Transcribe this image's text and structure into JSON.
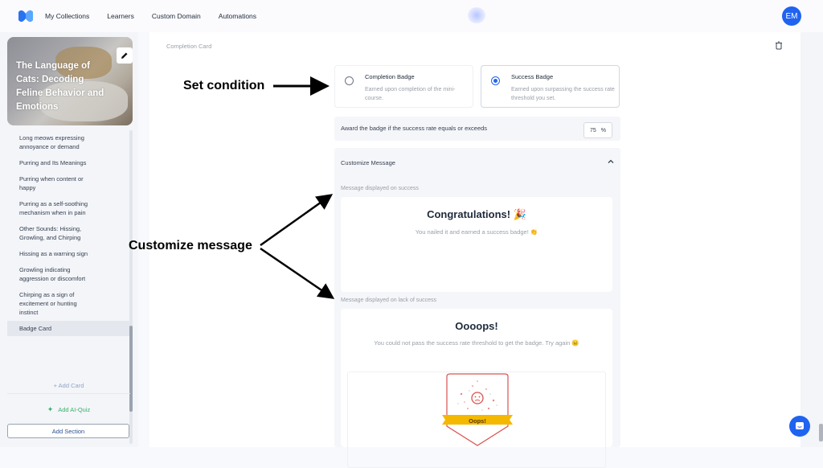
{
  "topbar": {
    "nav": [
      "My Collections",
      "Learners",
      "Custom Domain",
      "Automations"
    ],
    "avatar_initials": "EM"
  },
  "sidebar": {
    "cover_title": "The Language of Cats: Decoding Feline Behavior and Emotions",
    "items": [
      "Long meows expressing annoyance or demand",
      "Purring and Its Meanings",
      "Purring when content or happy",
      "Purring as a self-soothing mechanism when in pain",
      "Other Sounds: Hissing, Growling, and Chirping",
      "Hissing as a warning sign",
      "Growling indicating aggression or discomfort",
      "Chirping as a sign of excitement or hunting instinct",
      "Badge Card"
    ],
    "active_item": "Badge Card",
    "add_card": "+ Add Card",
    "add_ai_quiz": "Add AI-Quiz",
    "add_section": "Add Section"
  },
  "main": {
    "card_label": "Completion Card",
    "options": [
      {
        "title": "Completion Badge",
        "desc": "Earned upon completion of the mini-course.",
        "selected": false
      },
      {
        "title": "Success Badge",
        "desc": "Earned upon surpassing the success rate threshold you set.",
        "selected": true
      }
    ],
    "threshold_label": "Award the badge if the success rate equals or exceeds",
    "threshold_value": "75",
    "threshold_unit": "%",
    "customize_header": "Customize Message",
    "success_label": "Message displayed on success",
    "success_title": "Congratulations! 🎉",
    "success_text": "You  nailed it and earned a success badge! 👏",
    "fail_label": "Message displayed on lack of success",
    "fail_title": "Oooops!",
    "fail_text": "You could not pass the success rate threshold to get the badge. Try again 😐",
    "badge_ribbon": "Oops!",
    "colors": {
      "accent": "#2563eb",
      "ribbon": "#f5b800",
      "badge_outline": "#d9534f"
    }
  },
  "annotations": {
    "set_condition": "Set condition",
    "customize_message": "Customize message"
  }
}
